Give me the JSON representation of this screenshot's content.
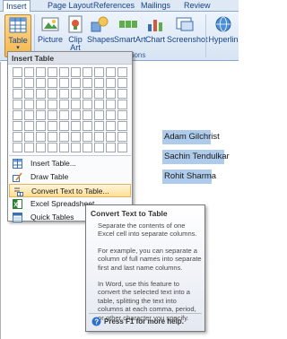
{
  "tabs": [
    {
      "label": "Insert",
      "active": true
    },
    {
      "label": "Page Layout",
      "active": false
    },
    {
      "label": "References",
      "active": false
    },
    {
      "label": "Mailings",
      "active": false
    },
    {
      "label": "Review",
      "active": false
    }
  ],
  "ribbon": {
    "buttons": [
      {
        "label": "Table",
        "icon": "table-icon"
      },
      {
        "label": "Picture",
        "icon": "picture-icon"
      },
      {
        "label": "Clip Art",
        "line1": "Clip",
        "line2": "Art",
        "icon": "clipart-icon"
      },
      {
        "label": "Shapes",
        "icon": "shapes-icon"
      },
      {
        "label": "SmartArt",
        "icon": "smartart-icon"
      },
      {
        "label": "Chart",
        "icon": "chart-icon"
      },
      {
        "label": "Screenshot",
        "icon": "screenshot-icon"
      },
      {
        "label": "Hyperlin",
        "icon": "hyperlink-icon"
      }
    ],
    "group_label": "ations"
  },
  "menu": {
    "title": "Insert Table",
    "grid": {
      "columns": 10,
      "rows": 8
    },
    "items": [
      {
        "label": "Insert Table...",
        "icon": "insert-table-icon",
        "highlighted": false
      },
      {
        "label": "Draw Table",
        "icon": "draw-table-icon",
        "highlighted": false
      },
      {
        "label": "Convert Text to Table...",
        "icon": "convert-text-icon",
        "highlighted": true
      },
      {
        "label": "Excel Spreadsheet",
        "icon": "excel-spreadsheet-icon",
        "highlighted": false
      },
      {
        "label": "Quick Tables",
        "icon": "quick-tables-icon",
        "highlighted": false
      }
    ]
  },
  "document": {
    "lines": [
      "Adam Gilchrist",
      "Sachin Tendulkar",
      "Rohit Sharma"
    ]
  },
  "tooltip": {
    "title": "Convert Text to Table",
    "paragraphs": [
      "Separate the contents of one Excel cell into separate columns.",
      "For example, you can separate a column of full names into separate first and last name columns.",
      "In Word, use this feature to convert the selected text into a table, splitting the text into columns at each comma, period, or other character you specify."
    ],
    "help": "Press F1 for more help."
  },
  "colors": {
    "ribbon_accent": "#15428b",
    "selection": "#aecbeb",
    "hover": "#ffdf95"
  }
}
